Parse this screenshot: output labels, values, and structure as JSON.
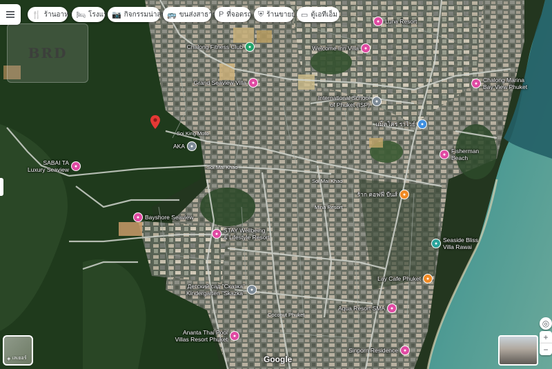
{
  "toolbar": {
    "chips": [
      {
        "icon": "restaurant-icon",
        "glyph": "🍴",
        "label": "ร้านอาหาร"
      },
      {
        "icon": "hotel-icon",
        "glyph": "🛏",
        "label": "โรงแรม"
      },
      {
        "icon": "camera-icon",
        "glyph": "📷",
        "label": "กิจกรรมน่าสนใจ"
      },
      {
        "icon": "bus-icon",
        "glyph": "🚌",
        "label": "ขนส่งสาธารณะ"
      },
      {
        "icon": "parking-icon",
        "glyph": "P",
        "label": "ที่จอดรถ"
      },
      {
        "icon": "pharmacy-icon",
        "glyph": "⛨",
        "label": "ร้านขายยา"
      },
      {
        "icon": "atm-icon",
        "glyph": "▭",
        "label": "ตู้เอทีเอ็ม"
      }
    ]
  },
  "watermark": {
    "text": "BRD"
  },
  "places": [
    {
      "name": "Luna Resort",
      "color": "pink"
    },
    {
      "name": "Welcome Inn Villa",
      "color": "pink"
    },
    {
      "name": "Chalong Marina\nBay View Phuket",
      "color": "pink"
    },
    {
      "name": "Chalong Fitness Club",
      "color": "green"
    },
    {
      "name": "Grand Seaview Villa",
      "color": "pink"
    },
    {
      "name": "International School\nof Phuket (ISP)",
      "color": "grey"
    },
    {
      "name": "แม็คโคร ราไวย์",
      "color": "blue"
    },
    {
      "name": "AKA",
      "color": "grey"
    },
    {
      "name": "SABAI TA\nLuxury Seaview",
      "color": "pink"
    },
    {
      "name": "Fisherman\nBeach",
      "color": "pink"
    },
    {
      "name": "ร้าก คอฟฟี่ บีนส์",
      "color": "orange"
    },
    {
      "name": "Bayshore Seaview",
      "color": "pink"
    },
    {
      "name": "STAY Wellbeing\n& Lifestyle Resort",
      "color": "pink"
    },
    {
      "name": "Seaside Bliss\nVilla Rawai",
      "color": "teal"
    },
    {
      "name": "Lay Cafe Phuket",
      "color": "orange"
    },
    {
      "name": "Детский сад \"Сказка\"\nKindergarten \"Skazka\"",
      "color": "grey"
    },
    {
      "name": "Aqua Resort SMA",
      "color": "pink"
    },
    {
      "name": "Ananta Thai Pool\nVillas Resort Phuket",
      "color": "pink"
    },
    {
      "name": "Sinporn Residence",
      "color": "pink"
    }
  ],
  "small_labels": [
    "Soi King Moto",
    "Soi Mai Khao",
    "Soi Mai Khao",
    "Mina Resort",
    "Coconut Phuket"
  ],
  "attribution": "Google",
  "layers": {
    "label": "เลเยอร์"
  },
  "map_controls": {
    "locate": "◎",
    "zoom_in": "+",
    "zoom_out": "−"
  }
}
